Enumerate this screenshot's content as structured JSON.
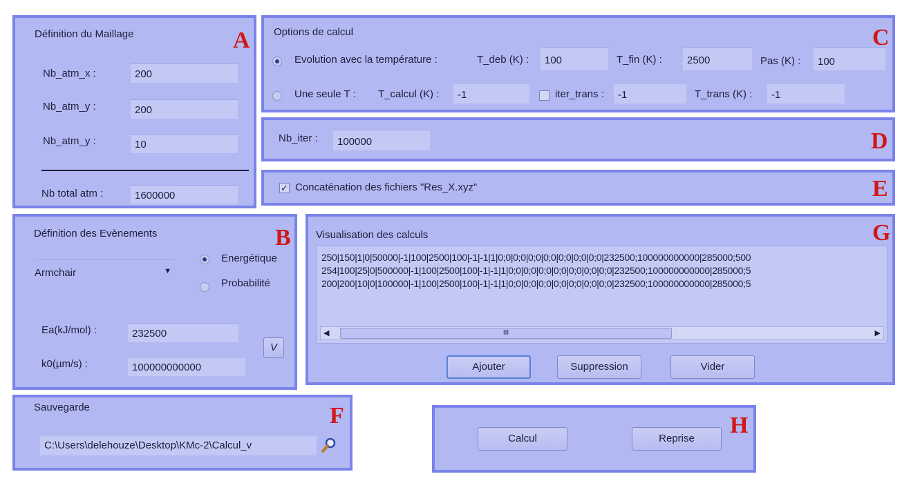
{
  "letters": {
    "A": "A",
    "B": "B",
    "C": "C",
    "D": "D",
    "E": "E",
    "F": "F",
    "G": "G",
    "H": "H"
  },
  "maillage": {
    "title": "Définition du Maillage",
    "nb_atm_x_label": "Nb_atm_x :",
    "nb_atm_x_value": "200",
    "nb_atm_y_label": "Nb_atm_y :",
    "nb_atm_y_value": "200",
    "nb_atm_z_label": "Nb_atm_y :",
    "nb_atm_z_value": "10",
    "nb_total_label": "Nb total atm :",
    "nb_total_value": "1600000"
  },
  "evenements": {
    "title": "Définition des Evènements",
    "type_selected": "Armchair",
    "radio_energetique": "Energétique",
    "radio_probabilite": "Probabilité",
    "ea_label": "Ea(kJ/mol) :",
    "ea_value": "232500",
    "k0_label": "k0(µm/s) :",
    "k0_value": "100000000000",
    "validate_label": "V"
  },
  "options": {
    "title": "Options de calcul",
    "evolution_label": "Evolution avec la température :",
    "t_deb_label": "T_deb (K) :",
    "t_deb_value": "100",
    "t_fin_label": "T_fin (K) :",
    "t_fin_value": "2500",
    "pas_label": "Pas (K) :",
    "pas_value": "100",
    "une_seule_label": "Une seule T :",
    "t_calcul_label": "T_calcul (K) :",
    "t_calcul_value": "-1",
    "iter_trans_label": "iter_trans :",
    "iter_trans_value": "-1",
    "t_trans_label": "T_trans (K) :",
    "t_trans_value": "-1"
  },
  "iterations": {
    "label": "Nb_iter :",
    "value": "100000"
  },
  "concat": {
    "label": "Concaténation des fichiers \"Res_X.xyz\"",
    "checked": true
  },
  "visualisation": {
    "title": "Visualisation des calculs",
    "lines": [
      "250|150|1|0|50000|-1|100|2500|100|-1|-1|1|0;0|0;0|0;0|0;0|0;0|0;0|0;0|232500;100000000000|285000;500",
      "254|100|25|0|500000|-1|100|2500|100|-1|-1|1|0;0|0;0|0;0|0;0|0;0|0;0|0;0|232500;100000000000|285000;5",
      "200|200|10|0|100000|-1|100|2500|100|-1|-1|1|0;0|0;0|0;0|0;0|0;0|0;0|0;0|232500;100000000000|285000;5"
    ],
    "scroll_grip": "III",
    "btn_ajouter": "Ajouter",
    "btn_suppression": "Suppression",
    "btn_vider": "Vider"
  },
  "sauvegarde": {
    "title": "Sauvegarde",
    "path": "C:\\Users\\delehouze\\Desktop\\KMc-2\\Calcul_v"
  },
  "actions": {
    "calcul": "Calcul",
    "reprise": "Reprise"
  },
  "colors": {
    "panel": "#b2b9f2",
    "panel_border": "#7a83ea",
    "letter": "#d01818"
  }
}
